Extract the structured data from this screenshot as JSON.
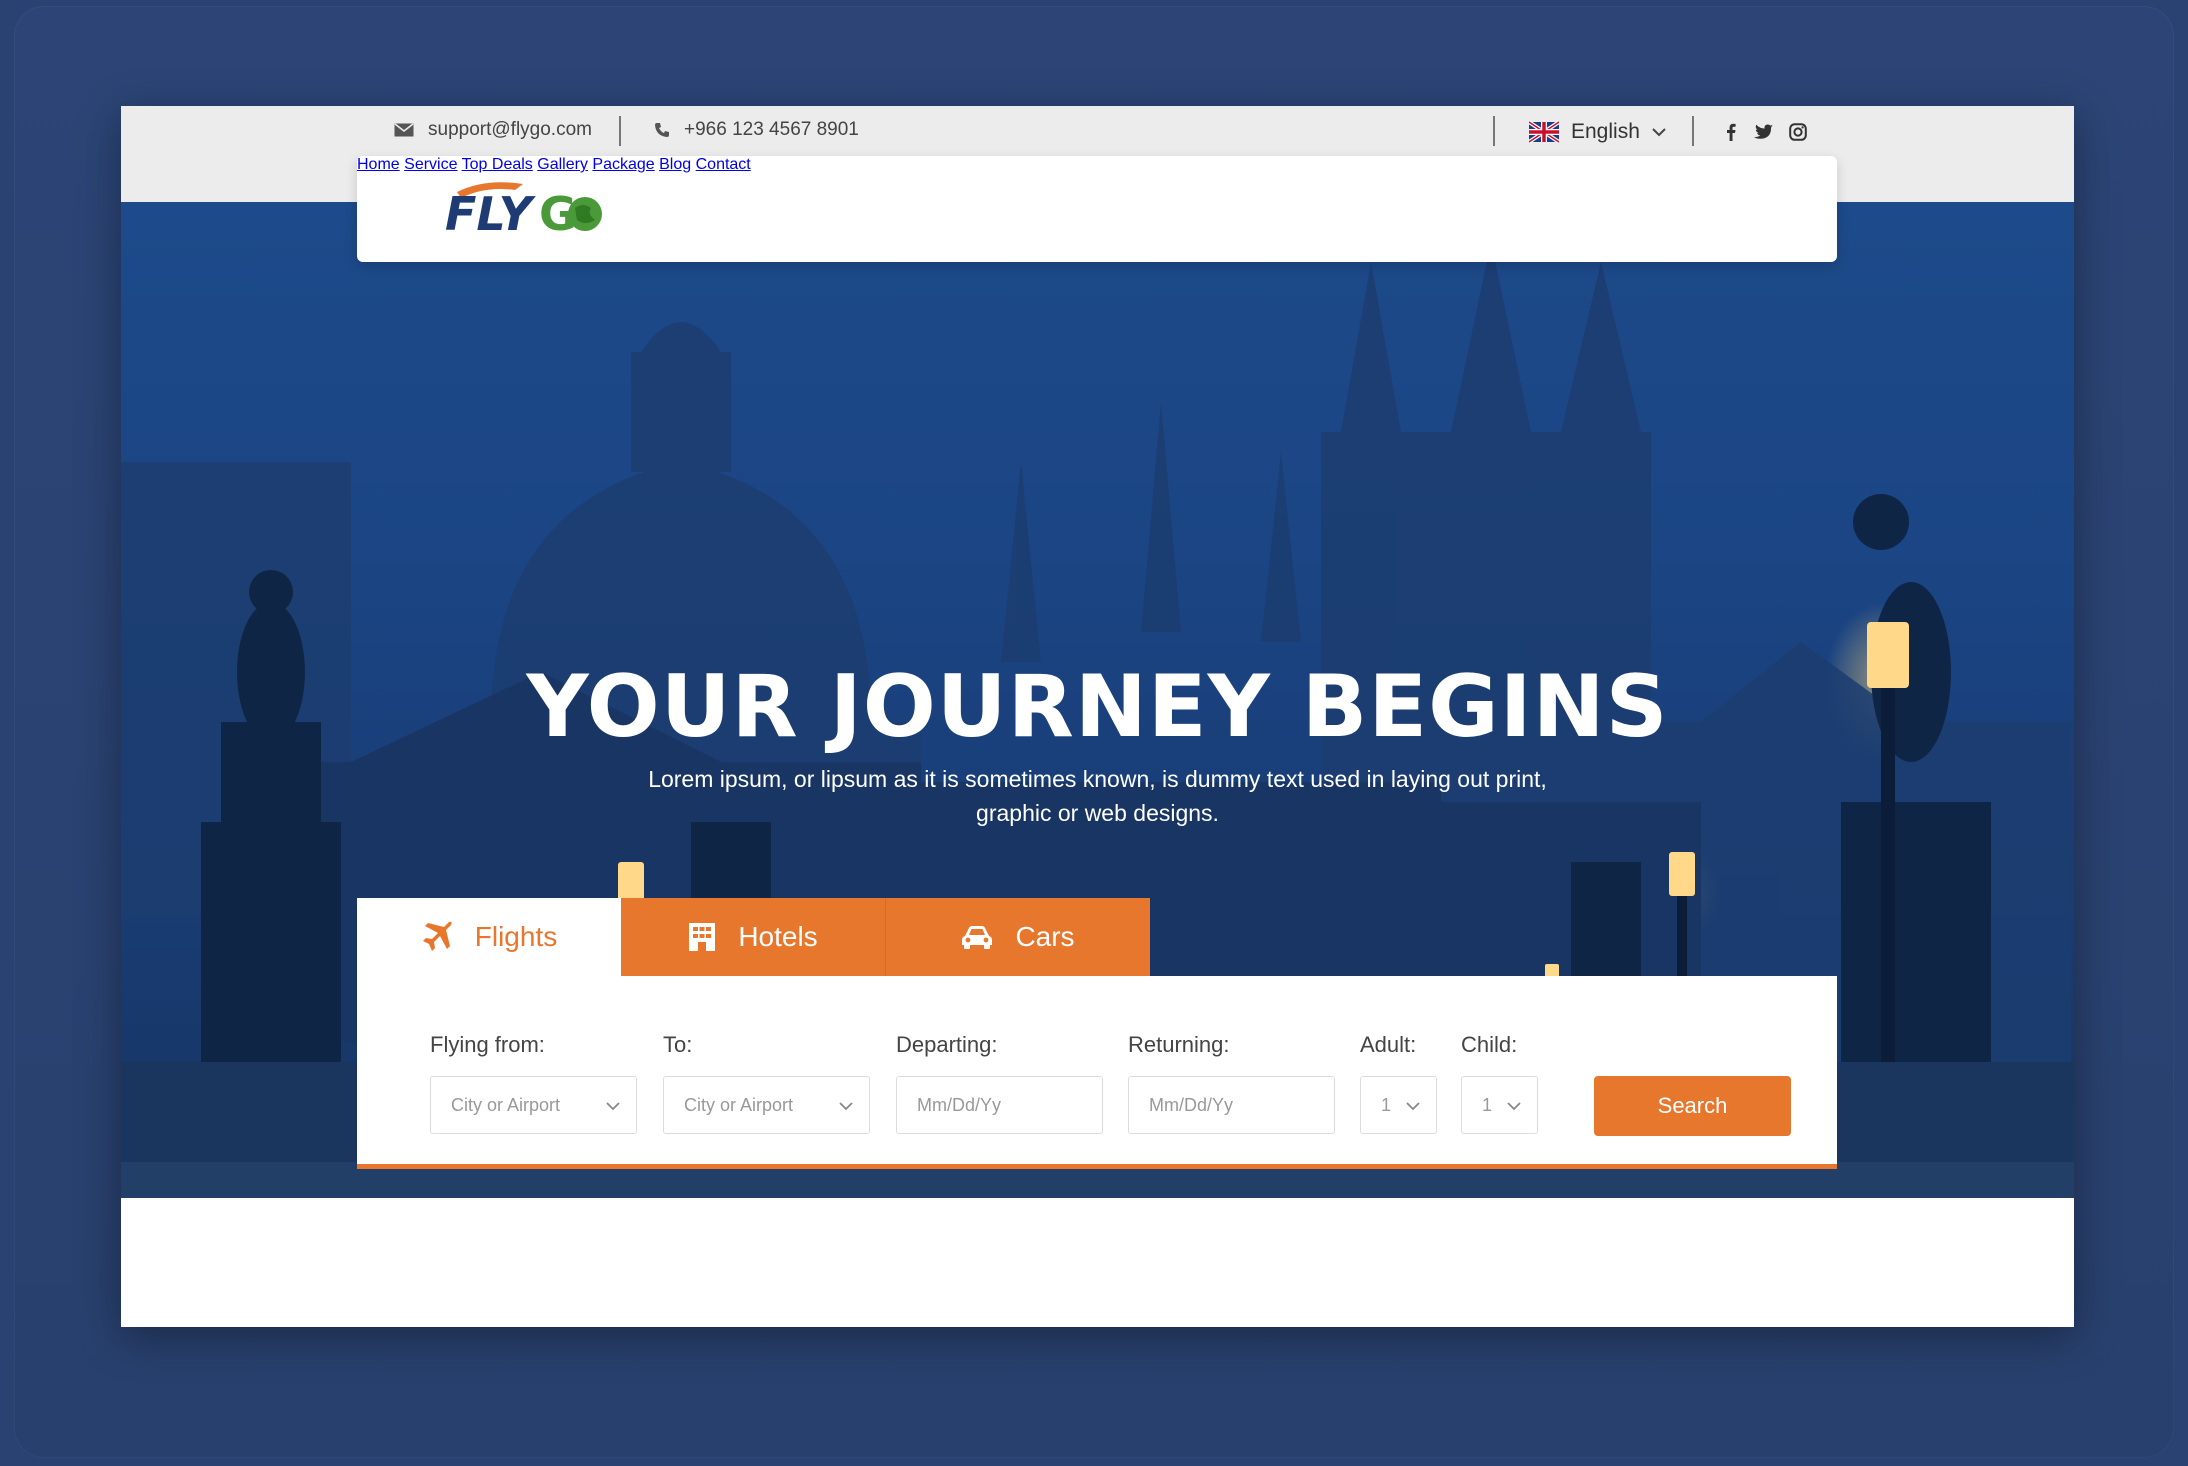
{
  "topbar": {
    "email": "support@flygo.com",
    "phone": "+966 123 4567 8901",
    "language": "English",
    "socials": [
      "facebook-icon",
      "twitter-icon",
      "instagram-icon"
    ]
  },
  "brand": {
    "logo_text": "FLYGO",
    "colors": {
      "navy": "#1f3b73",
      "orange": "#e8772e",
      "green": "#4a9a3a"
    }
  },
  "nav": {
    "items": [
      "Home",
      "Service",
      "Top Deals",
      "Gallery",
      "Package",
      "Blog",
      "Contact"
    ]
  },
  "hero": {
    "title": "YOUR JOURNEY BEGINS",
    "subtitle": "Lorem ipsum, or lipsum as it is sometimes known, is dummy text used in laying out print, graphic or web designs."
  },
  "tabs": [
    {
      "label": "Flights",
      "icon": "plane-icon",
      "active": true
    },
    {
      "label": "Hotels",
      "icon": "hotel-icon",
      "active": false
    },
    {
      "label": "Cars",
      "icon": "car-icon",
      "active": false
    }
  ],
  "search": {
    "from_label": "Flying from:",
    "from_placeholder": "City or Airport",
    "to_label": "To:",
    "to_placeholder": "City or Airport",
    "depart_label": "Departing:",
    "depart_placeholder": "Mm/Dd/Yy",
    "return_label": "Returning:",
    "return_placeholder": "Mm/Dd/Yy",
    "adult_label": "Adult:",
    "adult_value": "1",
    "child_label": "Child:",
    "child_value": "1",
    "button": "Search"
  },
  "theme": {
    "accent": "#e8772e",
    "background": "#2a4272"
  }
}
